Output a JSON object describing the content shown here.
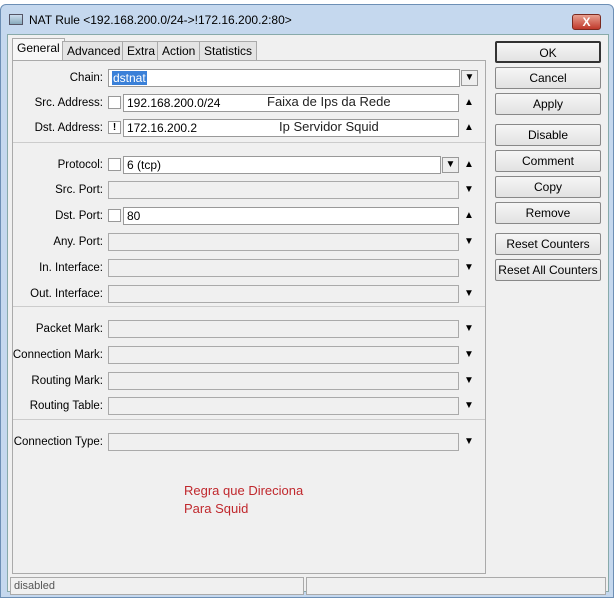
{
  "window": {
    "title": "NAT Rule <192.168.200.0/24->!172.16.200.2:80>",
    "close": "X"
  },
  "tabs": [
    "General",
    "Advanced",
    "Extra",
    "Action",
    "Statistics"
  ],
  "fields": {
    "chain": {
      "label": "Chain:",
      "value": "dstnat"
    },
    "src_address": {
      "label": "Src. Address:",
      "value": "192.168.200.0/24",
      "note": "Faixa de Ips da Rede"
    },
    "dst_address": {
      "label": "Dst. Address:",
      "value": "172.16.200.2",
      "negate": "!",
      "note": "Ip Servidor Squid"
    },
    "protocol": {
      "label": "Protocol:",
      "value": "6 (tcp)"
    },
    "src_port": {
      "label": "Src. Port:"
    },
    "dst_port": {
      "label": "Dst. Port:",
      "value": "80"
    },
    "any_port": {
      "label": "Any. Port:"
    },
    "in_interface": {
      "label": "In. Interface:"
    },
    "out_interface": {
      "label": "Out. Interface:"
    },
    "packet_mark": {
      "label": "Packet Mark:"
    },
    "connection_mark": {
      "label": "Connection Mark:"
    },
    "routing_mark": {
      "label": "Routing Mark:"
    },
    "routing_table": {
      "label": "Routing Table:"
    },
    "connection_type": {
      "label": "Connection Type:"
    }
  },
  "buttons": [
    "OK",
    "Cancel",
    "Apply",
    "Disable",
    "Comment",
    "Copy",
    "Remove",
    "Reset Counters",
    "Reset All Counters"
  ],
  "annotation": {
    "line1": "Regra que Direciona",
    "line2": "Para Squid"
  },
  "status": {
    "left": "disabled",
    "right": ""
  },
  "colors": {
    "annotation": "#c0282d",
    "selection": "#3a80d8"
  }
}
